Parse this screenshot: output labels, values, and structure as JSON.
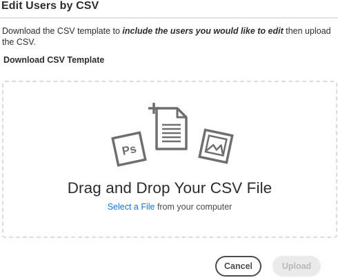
{
  "dialog": {
    "title": "Edit Users by CSV",
    "description_before": "Download the CSV template to ",
    "description_emphasis": "include the users you would like to edit",
    "description_after": " then upload the CSV.",
    "download_template_label": "Download CSV Template"
  },
  "dropzone": {
    "title": "Drag and Drop Your CSV File",
    "select_file_link": "Select a File",
    "select_file_suffix": " from your computer",
    "ps_badge": "Ps"
  },
  "footer": {
    "cancel_label": "Cancel",
    "upload_label": "Upload"
  },
  "colors": {
    "link": "#1473e6",
    "icon_gray": "#6e6e6e",
    "upload_disabled_bg": "#eaeaea"
  }
}
